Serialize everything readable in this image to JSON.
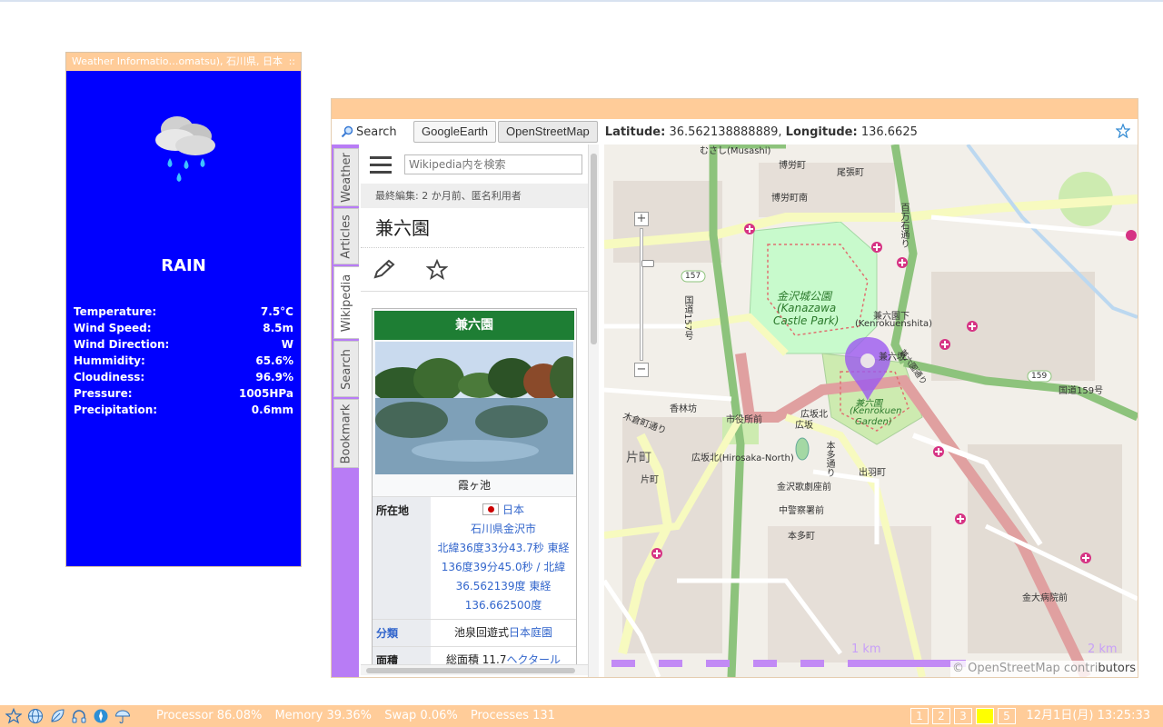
{
  "weather_widget": {
    "title": "Weather Informatio…omatsu), 石川県, 日本",
    "grip": "::",
    "condition": "RAIN",
    "icon": "rain-cloud-icon",
    "rows": [
      {
        "label": "Temperature:",
        "value": "7.5°C"
      },
      {
        "label": "Wind Speed:",
        "value": "8.5m"
      },
      {
        "label": "Wind Direction:",
        "value": "W"
      },
      {
        "label": "Hummidity:",
        "value": "65.6%"
      },
      {
        "label": "Cloudiness:",
        "value": "96.9%"
      },
      {
        "label": "Pressure:",
        "value": "1005HPa"
      },
      {
        "label": "Precipitation:",
        "value": "0.6mm"
      }
    ],
    "bg_color": "#0000ff"
  },
  "toolbar": {
    "search_label": "Search",
    "google_earth": "GoogleEarth",
    "openstreetmap": "OpenStreetMap",
    "lat_label": "Latitude:",
    "lat_value": "36.562138888889,",
    "lon_label": "Longitude:",
    "lon_value": "136.6625"
  },
  "side_tabs": [
    "Weather",
    "Articles",
    "Wikipedia",
    "Search",
    "Bookmark"
  ],
  "active_tab": "Wikipedia",
  "wikipedia": {
    "search_placeholder": "Wikipedia内を検索",
    "last_edit": "最終編集: 2 か月前、匿名利用者",
    "title": "兼六園",
    "infobox": {
      "title": "兼六園",
      "caption": "霞ヶ池",
      "location_label": "所在地",
      "location_lines": [
        "日本",
        "石川県金沢市",
        "北緯36度33分43.7秒 東経",
        "136度39分45.0秒 / 北緯",
        "36.562139度 東経",
        "136.662500度"
      ],
      "category_label": "分類",
      "category_prefix": "池泉回遊式",
      "category_link": "日本庭園",
      "area_label": "面積",
      "area_prefix": "総面積 11.7",
      "area_link": "ヘクタール"
    }
  },
  "map": {
    "labels": {
      "musashi": "むさし(Musashi)",
      "hakuro": "博労町",
      "obari": "尾張町",
      "hakuro_minami": "博労町南",
      "hyakumangoku": "百万石通り",
      "castle_jp": "金沢城公園",
      "castle_en1": "(Kanazawa",
      "castle_en2": "Castle Park)",
      "kenrokuenshita": "兼六園下",
      "kenrokuenshita_en": "(Kenrokuenshita)",
      "kenrokuzaka": "兼六坂",
      "route157": "国道157号",
      "badge157": "157",
      "badge159": "159",
      "route159": "国道159号",
      "korinbo": "香林坊",
      "kidamachi": "木倉町通り",
      "shiyakusho": "市役所前",
      "hirosaka_kita": "広坂北",
      "hirosaka": "広坂",
      "kenrokuen_jp": "兼六園",
      "kenrokuen_en1": "(Kenrokuen",
      "kenrokuen_en2": "Garden)",
      "katamachi_big": "片町",
      "katamachi": "片町",
      "hirosaka_north": "広坂北(Hirosaka-North)",
      "kanazawa_kabuki": "金沢歌劇座前",
      "izuwamachi": "出羽町",
      "chukeisatsu": "中警察署前",
      "hondamachi": "本多町",
      "hirosaka_dori": "本多通り",
      "kandaibyoin": "金大病院前",
      "kenroku_street": "兼六園通り"
    },
    "scale_1km": "1 km",
    "scale_2km": "2 km",
    "attribution_pre": "© OpenStreetMap contri",
    "attribution_post": "butors"
  },
  "taskbar": {
    "processor": "Processor 86.08%",
    "memory": "Memory 39.36%",
    "swap": "Swap  0.06%",
    "processes": "Processes 131",
    "workspaces": [
      "1",
      "2",
      "3",
      "4",
      "5"
    ],
    "current_workspace": "4",
    "clock": "12月1日(月) 13:25:33",
    "icons": [
      "star-icon",
      "globe-icon",
      "leaf-icon",
      "headphones-icon",
      "compass-icon",
      "umbrella-icon"
    ]
  }
}
